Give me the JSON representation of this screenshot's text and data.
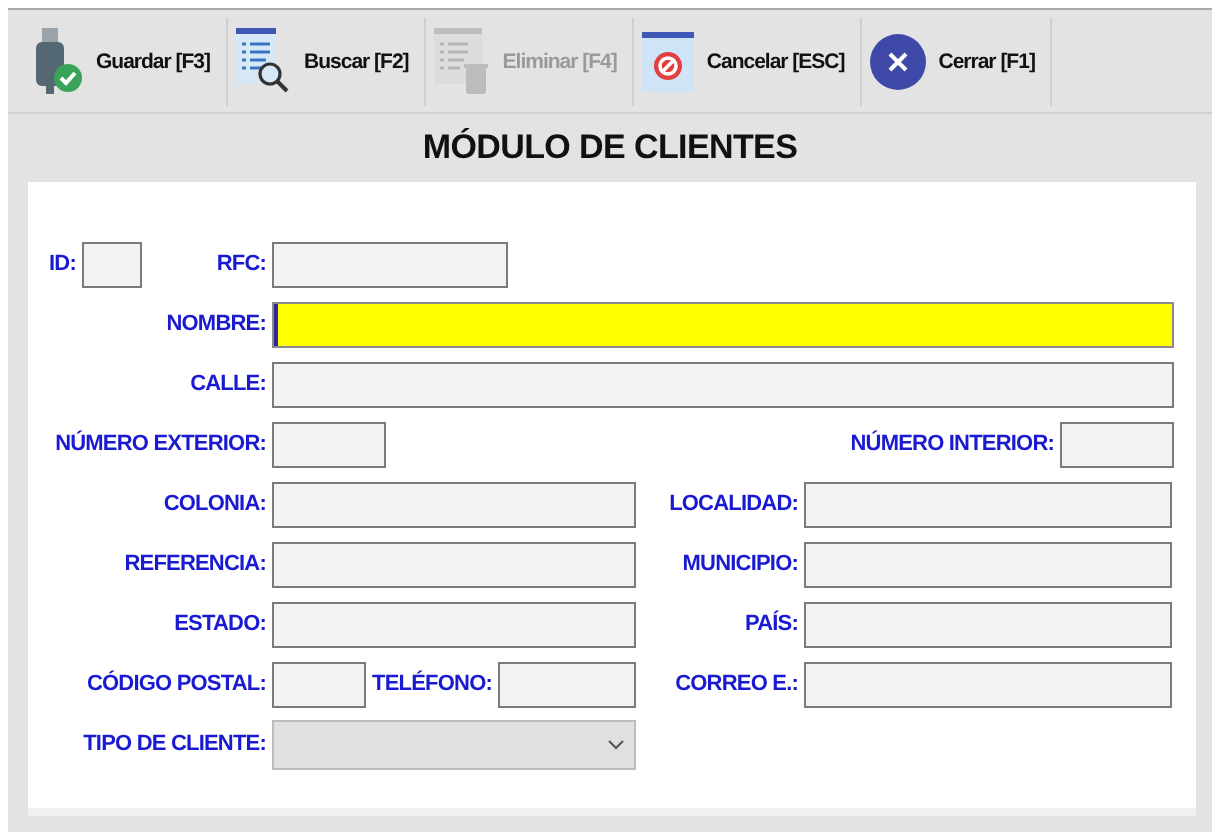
{
  "toolbar": [
    {
      "label": "Guardar [F3]",
      "kind": "save",
      "disabled": false
    },
    {
      "label": "Buscar [F2]",
      "kind": "search",
      "disabled": false
    },
    {
      "label": "Eliminar [F4]",
      "kind": "delete",
      "disabled": true
    },
    {
      "label": "Cancelar [ESC]",
      "kind": "cancel",
      "disabled": false
    },
    {
      "label": "Cerrar [F1]",
      "kind": "close",
      "disabled": false
    }
  ],
  "title": "MÓDULO DE CLIENTES",
  "rows": [
    {
      "fields": [
        {
          "label": "ID:",
          "kind": "text",
          "focused": false,
          "disabled": false
        },
        {
          "label": "RFC:",
          "kind": "text",
          "focused": false,
          "disabled": false
        }
      ]
    },
    {
      "fields": [
        {
          "label": "NOMBRE:",
          "kind": "text",
          "focused": true,
          "disabled": false
        }
      ]
    },
    {
      "fields": [
        {
          "label": "CALLE:",
          "kind": "text",
          "focused": false,
          "disabled": false
        }
      ]
    },
    {
      "fields": [
        {
          "label": "NÚMERO EXTERIOR:",
          "kind": "text",
          "focused": false,
          "disabled": false
        },
        {
          "label": "NÚMERO INTERIOR:",
          "kind": "text",
          "focused": false,
          "disabled": false
        }
      ]
    },
    {
      "fields": [
        {
          "label": "COLONIA:",
          "kind": "text",
          "focused": false,
          "disabled": false
        },
        {
          "label": "LOCALIDAD:",
          "kind": "text",
          "focused": false,
          "disabled": false
        }
      ]
    },
    {
      "fields": [
        {
          "label": "REFERENCIA:",
          "kind": "text",
          "focused": false,
          "disabled": false
        },
        {
          "label": "MUNICIPIO:",
          "kind": "text",
          "focused": false,
          "disabled": false
        }
      ]
    },
    {
      "fields": [
        {
          "label": "ESTADO:",
          "kind": "text",
          "focused": false,
          "disabled": false
        },
        {
          "label": "PAÍS:",
          "kind": "text",
          "focused": false,
          "disabled": false
        }
      ]
    },
    {
      "fields": [
        {
          "label": "CÓDIGO POSTAL:",
          "kind": "text",
          "focused": false,
          "disabled": false
        },
        {
          "label": "TELÉFONO:",
          "kind": "text",
          "focused": false,
          "disabled": false
        },
        {
          "label": "CORREO E.:",
          "kind": "text",
          "focused": false,
          "disabled": false
        }
      ]
    },
    {
      "fields": [
        {
          "label": "TIPO DE CLIENTE:",
          "kind": "select",
          "focused": false,
          "disabled": true
        }
      ]
    }
  ]
}
